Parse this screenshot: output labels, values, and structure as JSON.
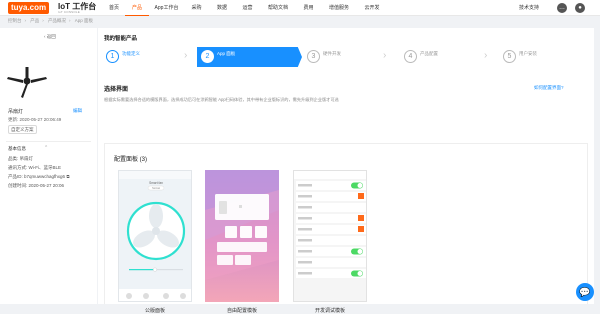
{
  "header": {
    "logo": "tuya.com",
    "title": "IoT 工作台",
    "subtitle": "IoT CONSOLE",
    "nav": [
      "首页",
      "产品",
      "App工作台",
      "采购",
      "数据",
      "运营",
      "帮助文档",
      "费用",
      "增值服务",
      "云开发"
    ],
    "active_nav": "产品",
    "tech_support": "技术支持"
  },
  "breadcrumb": [
    "控制台",
    "产品",
    "产品概况",
    "App 面板"
  ],
  "sidebar": {
    "back": "返回",
    "device_name": "吊扇灯",
    "update_label": "更新",
    "update_time": "2020-05-27 20:06:49",
    "edit": "编辑",
    "customize_btn": "自定义方案",
    "basic_info_title": "基本信息",
    "info": [
      {
        "label": "品类",
        "value": "吊扇灯"
      },
      {
        "label": "通讯方式",
        "value": "Wi-Fi、蓝牙BLE"
      },
      {
        "label": "产品ID",
        "value": "b7qmuwwchagfhxg6"
      },
      {
        "label": "创建时间",
        "value": "2020-05-27 20:06"
      }
    ]
  },
  "main": {
    "title": "我的智能产品",
    "steps": [
      {
        "num": "1",
        "label": "功能定义",
        "state": "done"
      },
      {
        "num": "2",
        "label": "App 面板",
        "state": "active"
      },
      {
        "num": "3",
        "label": "硬件开发",
        "state": "todo"
      },
      {
        "num": "4",
        "label": "产品配置",
        "state": "todo"
      },
      {
        "num": "5",
        "label": "用户安装",
        "state": "todo"
      }
    ],
    "section_title": "选择界面",
    "section_desc": "根据实际需要选择合适的模版界面，选择成功后可在涂鸦智能 App扫码体验，其中带有企业版标识的，需先升级到企业版才可选",
    "how_link": "如何配置界面?",
    "panel_title": "配置面板 (3)",
    "panels": [
      {
        "name": "公版面板"
      },
      {
        "name": "自由配置模板"
      },
      {
        "name": "开发调试模板"
      }
    ]
  },
  "mock_phone": {
    "fan_title": "Smart fan",
    "fan_sub": "Normal"
  },
  "colors": {
    "brand": "#ff5a00",
    "accent": "#1890ff",
    "toggle_on": "#4cd964",
    "button_orange": "#ff6a1a"
  }
}
